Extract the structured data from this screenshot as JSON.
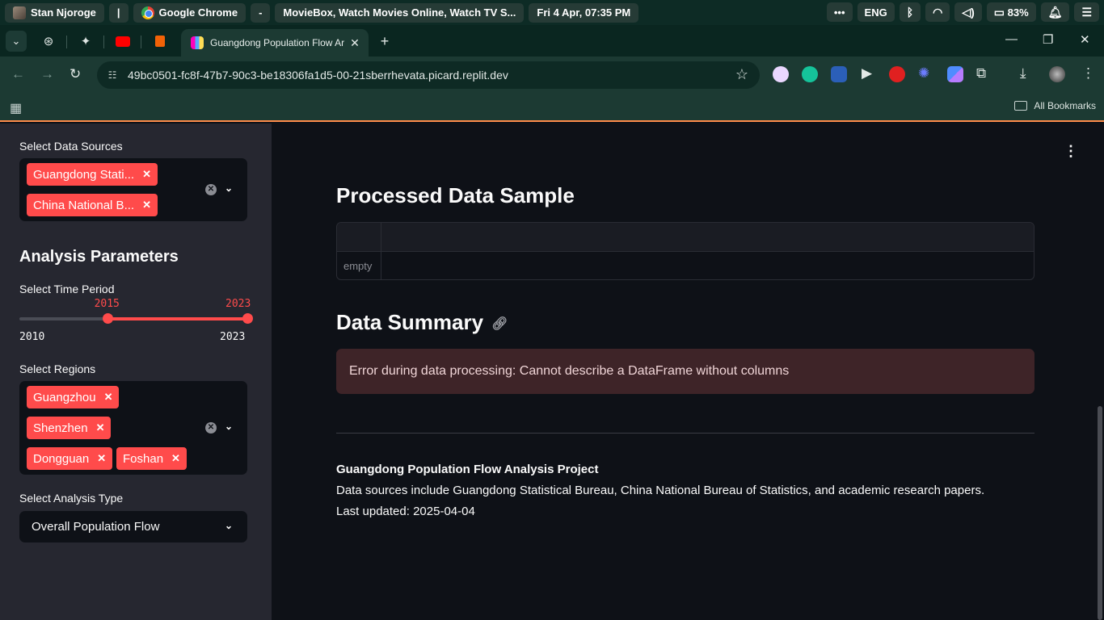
{
  "os_bar": {
    "user": "Stan Njoroge",
    "divider": "|",
    "app": "Google Chrome",
    "dash": "-",
    "window_title": "MovieBox, Watch Movies Online, Watch TV S...",
    "datetime": "Fri 4 Apr, 07:35 PM",
    "more": "•••",
    "language": "ENG",
    "battery": "83%"
  },
  "browser": {
    "active_tab_title": "Guangdong Population Flow Ar",
    "url": "49bc0501-fc8f-47b7-90c3-be18306fa1d5-00-21sberrhevata.picard.replit.dev",
    "all_bookmarks": "All Bookmarks"
  },
  "sidebar": {
    "data_sources_label": "Select Data Sources",
    "data_sources": [
      "Guangdong Stati...",
      "China National B..."
    ],
    "analysis_title": "Analysis Parameters",
    "time_period_label": "Select Time Period",
    "time_period": {
      "min": "2010",
      "max": "2023",
      "start": "2015",
      "end": "2023",
      "start_fraction": 0.385,
      "end_fraction": 1.0
    },
    "regions_label": "Select Regions",
    "regions": [
      "Guangzhou",
      "Shenzhen",
      "Dongguan",
      "Foshan"
    ],
    "analysis_type_label": "Select Analysis Type",
    "analysis_type": "Overall Population Flow"
  },
  "main": {
    "processed_title": "Processed Data Sample",
    "empty_label": "empty",
    "summary_title": "Data Summary",
    "error_message": "Error during data processing: Cannot describe a DataFrame without columns",
    "footer_title": "Guangdong Population Flow Analysis Project",
    "footer_sources": "Data sources include Guangdong Statistical Bureau, China National Bureau of Statistics, and academic research papers.",
    "footer_updated": "Last updated: 2025-04-04"
  },
  "colors": {
    "accent": "#ff4b4b",
    "sidebar_bg": "#262730",
    "main_bg": "#0e1117",
    "error_bg": "#3e2428"
  }
}
